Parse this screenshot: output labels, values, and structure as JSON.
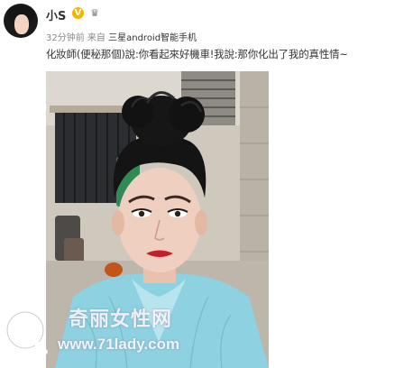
{
  "user": {
    "name": "小S",
    "verified_badge": "V",
    "member_icon": "crown-icon"
  },
  "meta": {
    "time": "32分钟前",
    "from_label": "来自",
    "source": "三星android智能手机"
  },
  "post": {
    "text": "化妝師(便秘那個)說:你看起來好機車!我說:那你化出了我的真性情~"
  },
  "watermark": {
    "site_name": "奇丽女性网",
    "url": "www.71lady.com"
  },
  "colors": {
    "badge": "#f7b500",
    "text": "#333333",
    "meta": "#888888"
  }
}
